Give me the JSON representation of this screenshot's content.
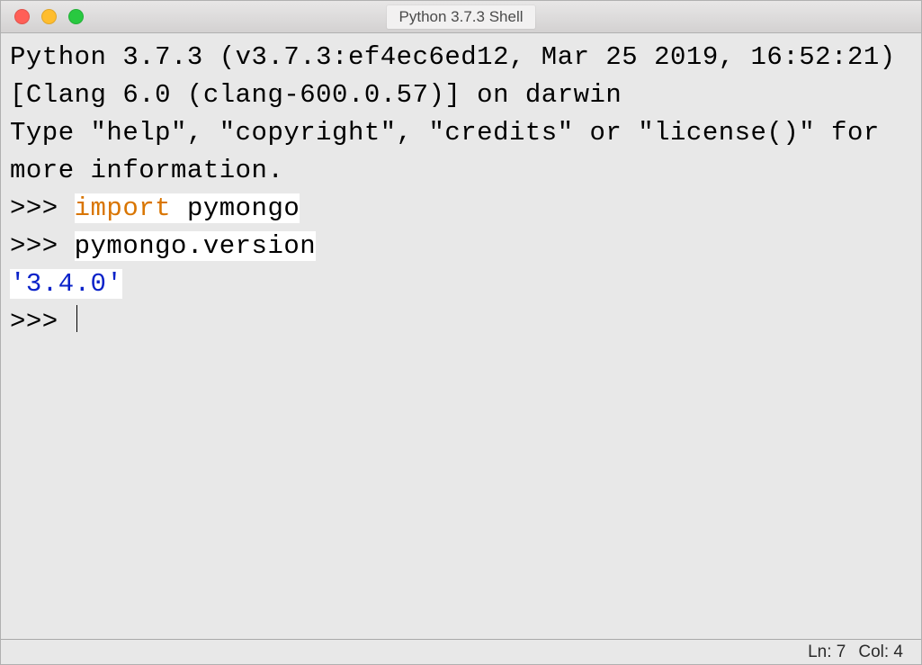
{
  "window": {
    "title": "Python 3.7.3 Shell"
  },
  "shell": {
    "banner_line1": "Python 3.7.3 (v3.7.3:ef4ec6ed12, Mar 25 2019, 16:52:21) ",
    "banner_line2": "[Clang 6.0 (clang-600.0.57)] on darwin",
    "banner_line3": "Type \"help\", \"copyright\", \"credits\" or \"license()\" for more information.",
    "prompt": ">>> ",
    "input1_keyword": "import",
    "input1_rest": " pymongo",
    "input2": "pymongo.version",
    "output1": "'3.4.0'"
  },
  "status": {
    "line": "Ln: 7",
    "col": "Col: 4"
  }
}
